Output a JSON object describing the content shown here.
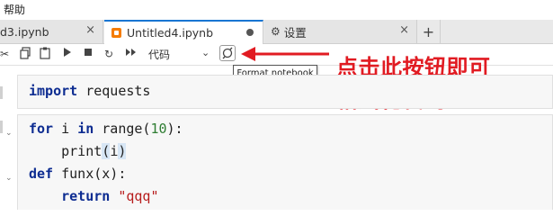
{
  "menu": {
    "help_label": "帮助"
  },
  "tabs": [
    {
      "label": "d3.ipynb",
      "close": "×"
    },
    {
      "label": "Untitled4.ipynb",
      "close": "●"
    },
    {
      "label": "设置",
      "close": "×"
    }
  ],
  "tab_add": "+",
  "toolbar": {
    "cell_type": "代码",
    "chevron": "⌄",
    "tooltip": "Format notebook"
  },
  "annotation": {
    "line1": "点击此按钮即可",
    "line2": "格式化代码"
  },
  "cells": [
    {
      "lines": [
        {
          "kw": "import",
          "rest": " requests"
        }
      ]
    },
    {
      "line1": {
        "kw1": "for",
        "a": " i ",
        "kw2": "in",
        "b": " range(",
        "num": "10",
        "c": "):"
      },
      "line2": {
        "a": "    print",
        "hl1": "(",
        "b": "i",
        "hl2": ")"
      },
      "line3": {
        "kw": "def",
        "rest": " funx(x):"
      },
      "line4": {
        "a": "    ",
        "kw": "return",
        "sp": " ",
        "str": "\"qqq\""
      }
    }
  ],
  "colors": {
    "accent": "#1976d2",
    "annotation": "#e11b22",
    "arrow": "#e11b22"
  }
}
